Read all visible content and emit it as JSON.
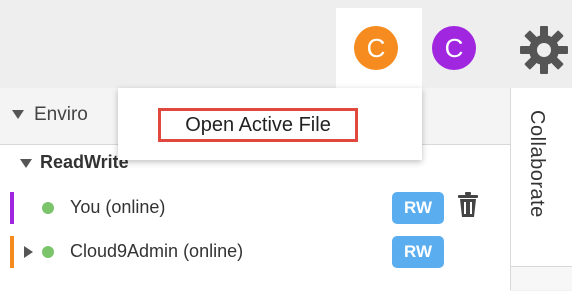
{
  "topbar": {
    "avatars": [
      {
        "initial": "C",
        "color": "#f68c1f",
        "active": true
      },
      {
        "initial": "C",
        "color": "#a126e0",
        "active": false
      }
    ],
    "settings_icon": "gear-icon"
  },
  "environment": {
    "title": "Enviro",
    "group_title": "ReadWrite",
    "members": [
      {
        "label": "You (online)",
        "badge": "RW",
        "bar_color": "#a126e0",
        "status_color": "#7bc46a",
        "has_delete": true
      },
      {
        "label": "Cloud9Admin (online)",
        "badge": "RW",
        "bar_color": "#f68c1f",
        "status_color": "#7bc46a",
        "has_delete": false
      }
    ]
  },
  "dropdown": {
    "item": "Open Active File"
  },
  "side_panel": {
    "tab_label": "Collaborate"
  }
}
